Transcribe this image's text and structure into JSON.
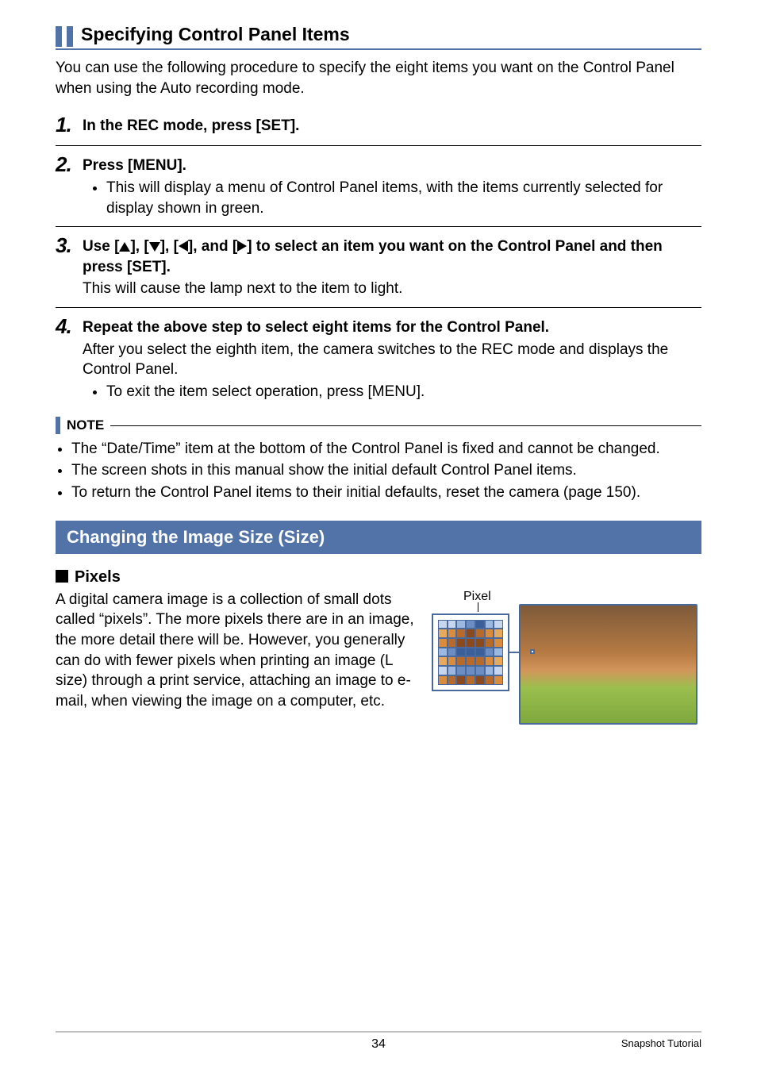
{
  "heading1": "Specifying Control Panel Items",
  "intro": "You can use the following procedure to specify the eight items you want on the Control Panel when using the Auto recording mode.",
  "steps": [
    {
      "num": "1.",
      "title": "In the REC mode, press [SET]."
    },
    {
      "num": "2.",
      "title": "Press [MENU].",
      "bullets": [
        "This will display a menu of Control Panel items, with the items currently selected for display shown in green."
      ]
    },
    {
      "num": "3.",
      "title_pre": "Use [",
      "title_mid1": "], [",
      "title_mid2": "], [",
      "title_mid3": "], and [",
      "title_post": "] to select an item you want on the Control Panel and then press [SET].",
      "desc": "This will cause the lamp next to the item to light."
    },
    {
      "num": "4.",
      "title": "Repeat the above step to select eight items for the Control Panel.",
      "desc": "After you select the eighth item, the camera switches to the REC mode and displays the Control Panel.",
      "bullets": [
        "To exit the item select operation, press [MENU]."
      ]
    }
  ],
  "note_label": "NOTE",
  "notes": [
    "The “Date/Time” item at the bottom of the Control Panel is fixed and cannot be changed.",
    "The screen shots in this manual show the initial default Control Panel items.",
    "To return the Control Panel items to their initial defaults, reset the camera (page 150)."
  ],
  "section_bar": "Changing the Image Size (Size)",
  "pixels_h": "Pixels",
  "pixels_body": "A digital camera image is a collection of small dots called “pixels”. The more pixels there are in an image, the more detail there will be. However, you generally can do with fewer pixels when printing an image (L size) through a print service, attaching an image to e-mail, when viewing the image on a computer, etc.",
  "pixel_label": "Pixel",
  "page_number": "34",
  "footer_label": "Snapshot Tutorial"
}
